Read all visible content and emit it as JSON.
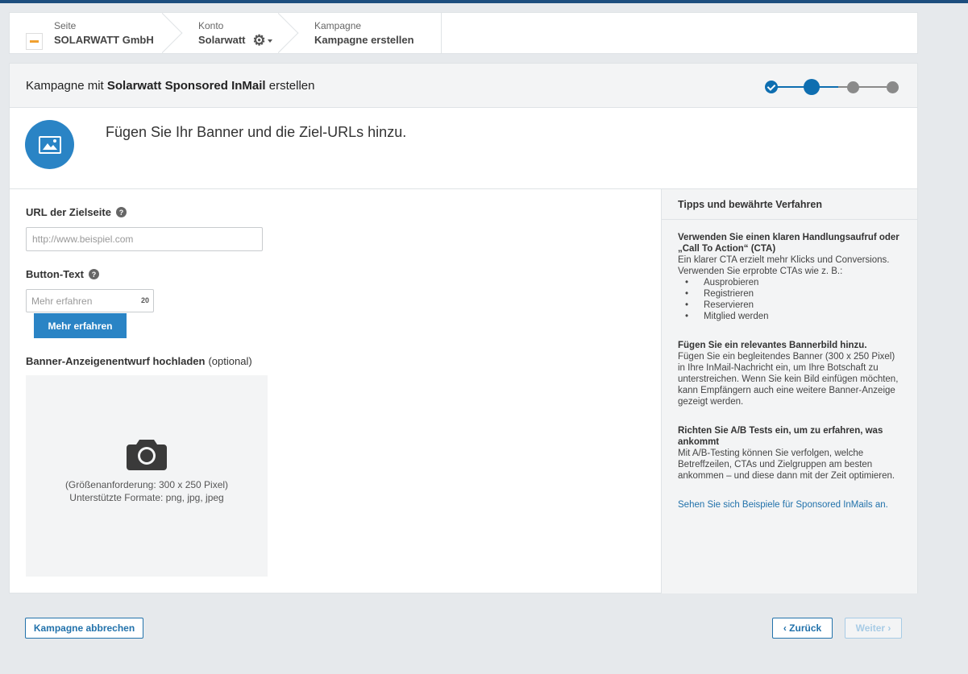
{
  "breadcrumb": {
    "site": {
      "label": "Seite",
      "value": "SOLARWATT GmbH"
    },
    "account": {
      "label": "Konto",
      "value": "Solarwatt"
    },
    "campaign": {
      "label": "Kampagne",
      "value": "Kampagne erstellen"
    }
  },
  "header": {
    "title_prefix": "Kampagne mit",
    "title_bold": "Solarwatt Sponsored InMail",
    "title_suffix": "erstellen",
    "steps": {
      "total": 4,
      "completed": 1,
      "current": 2
    }
  },
  "intro": {
    "text": "Fügen Sie Ihr Banner und die Ziel-URLs hinzu.",
    "icon": "image-icon"
  },
  "form": {
    "url_label": "URL der Zielseite",
    "url_placeholder": "http://www.beispiel.com",
    "button_text_label": "Button-Text",
    "button_text_placeholder": "Mehr erfahren",
    "button_text_counter": "20",
    "button_preview_label": "Mehr erfahren",
    "banner_label": "Banner-Anzeigenentwurf hochladen",
    "banner_optional": "(optional)",
    "upload_size": "(Größenanforderung: 300 x 250 Pixel)",
    "upload_formats": "Unterstützte Formate: png, jpg, jpeg",
    "upload_icon": "camera-icon"
  },
  "tips": {
    "title": "Tipps und bewährte Verfahren",
    "items": [
      {
        "heading": "Verwenden Sie einen klaren Handlungsaufruf oder „Call To Action“ (CTA)",
        "text": "Ein klarer CTA erzielt mehr Klicks und Conversions. Verwenden Sie erprobte CTAs wie z. B.:",
        "bullets": [
          "Ausprobieren",
          "Registrieren",
          "Reservieren",
          "Mitglied werden"
        ]
      },
      {
        "heading": "Fügen Sie ein relevantes Bannerbild hinzu.",
        "text": "Fügen Sie ein begleitendes Banner (300 x 250 Pixel) in Ihre InMail-Nachricht ein, um Ihre Botschaft zu unterstreichen. Wenn Sie kein Bild einfügen möchten, kann Empfängern auch eine weitere Banner-Anzeige gezeigt werden."
      },
      {
        "heading": "Richten Sie A/B Tests ein, um zu erfahren, was ankommt",
        "text": "Mit A/B-Testing können Sie verfolgen, welche Betreffzeilen, CTAs und Zielgruppen am besten ankommen – und diese dann mit der Zeit optimieren."
      }
    ],
    "link": "Sehen Sie sich Beispiele für Sponsored InMails an."
  },
  "footer": {
    "cancel": "Kampagne abbrechen",
    "back": "‹ Zurück",
    "next": "Weiter ›"
  },
  "colors": {
    "accent": "#2a84c5",
    "link": "#2272ab",
    "topbar": "#1d4e7e",
    "step_todo": "#8a8a8a"
  }
}
